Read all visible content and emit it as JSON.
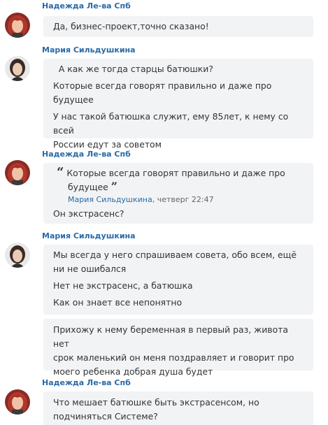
{
  "messages": [
    {
      "author": "Надежда Ле-ва Спб",
      "avatar_icon": "avatar-woman-red-hair",
      "bubbles": [
        {
          "lines": [
            "Да, бизнес-проект,точно сказано!"
          ]
        }
      ]
    },
    {
      "author": "Мария Сильдушкина",
      "avatar_icon": "avatar-woman-dark-hair",
      "bubbles": [
        {
          "p1": "  А как же тогда старцы батюшки?",
          "p2a": "Которые всегда говорят правильно и даже про",
          "p2b": "будущее",
          "p3a": "У нас такой батюшка служит, ему 85лет, к нему со всей",
          "p3b": "России едут за советом"
        }
      ]
    },
    {
      "author": "Надежда Ле-ва Спб",
      "avatar_icon": "avatar-woman-red-hair",
      "quote": {
        "open_mark": "“",
        "close_mark": "”",
        "line1": "Которые всегда говорят правильно и даже про",
        "line2": "будущее",
        "author": "Мария Сильдушкина",
        "date": ", четверг 22:47"
      },
      "reply": "Он экстрасенс?"
    },
    {
      "author": "Мария Сильдушкина",
      "avatar_icon": "avatar-woman-dark-hair",
      "bubble1": {
        "p1a": "Мы всегда у него спрашиваем совета, обо всем, ещё",
        "p1b": "ни не ошибался",
        "p2": "Нет не экстрасенс, а батюшка",
        "p3": "Как он знает все непонятно"
      },
      "bubble2": {
        "l1": "Прихожу к нему беременная в первый раз, живота нет",
        "l2": "срок маленький он меня поздравляет и говорит про",
        "l3": "моего ребенка добрая душа будет"
      }
    },
    {
      "author": "Надежда Ле-ва Спб",
      "avatar_icon": "avatar-woman-red-hair",
      "bubble": {
        "l1": "Что мешает батюшке быть экстрасенсом, но",
        "l2": "подчиняться Системе?"
      }
    }
  ]
}
